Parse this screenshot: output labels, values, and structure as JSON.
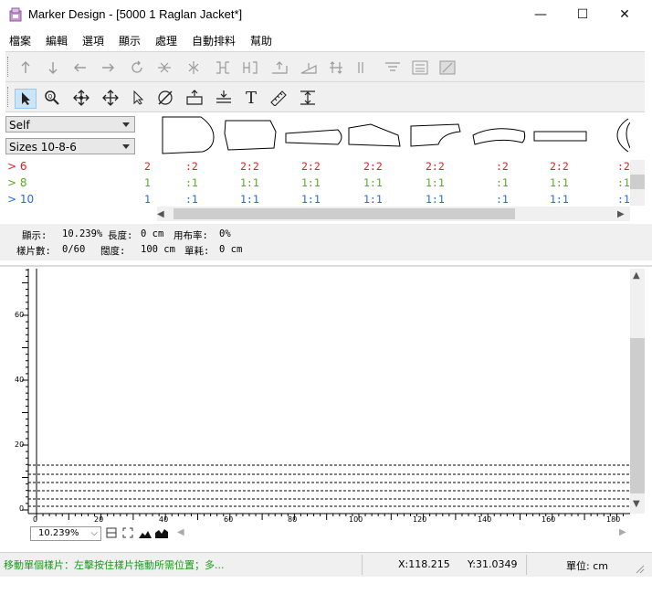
{
  "window": {
    "title": "Marker Design - [5000 1 Raglan Jacket*]",
    "controls": {
      "minimize": "—",
      "maximize": "☐",
      "close": "✕"
    }
  },
  "menu": [
    "檔案",
    "編輯",
    "選項",
    "顯示",
    "處理",
    "自動排料",
    "幫助"
  ],
  "toolbar1_icons": [
    "move-up-icon",
    "move-down-icon",
    "move-left-icon",
    "move-right-icon",
    "rotate-icon",
    "flip-vertical-icon",
    "flip-horizontal-icon",
    "join-right-icon",
    "join-left-icon",
    "tilt-up-icon",
    "tilt-down-icon",
    "spread-vertical-icon",
    "align-bar-icon",
    "align-top-icon",
    "align-center-icon",
    "select-all-icon"
  ],
  "toolbar2_icons": [
    "select-arrow-icon",
    "zoom-icon",
    "pan-icon",
    "move-cross-icon",
    "pointer-icon",
    "measure-icon",
    "piece-info-icon",
    "bundle-icon",
    "text-icon",
    "ruler-icon",
    "fit-height-icon"
  ],
  "toolbar2_glyphs": {
    "text": "T"
  },
  "selectors": {
    "fabric": "Self",
    "sizes": "Sizes 10-8-6"
  },
  "sizes": [
    {
      "label": "> 6",
      "color": "#e02020",
      "cells": [
        "2",
        ":2",
        "2:2",
        "2:2",
        "2:2",
        "2:2",
        ":2",
        "2:2",
        ":2"
      ]
    },
    {
      "label": "> 8",
      "color": "#5aaa20",
      "cells": [
        "1",
        ":1",
        "1:1",
        "1:1",
        "1:1",
        "1:1",
        ":1",
        "1:1",
        ":1"
      ]
    },
    {
      "label": "> 10",
      "color": "#2a6ad8",
      "cells": [
        "1",
        ":1",
        "1:1",
        "1:1",
        "1:1",
        "1:1",
        ":1",
        "1:1",
        ":1"
      ]
    }
  ],
  "info": {
    "display_label": "顯示:",
    "display_value": "10.239%",
    "length_label": "長度:",
    "length_value": "0 cm",
    "usage_label": "用布率:",
    "usage_value": "0%",
    "pieces_label": "樣片數:",
    "pieces_value": "0/60",
    "width_label": "闊度:",
    "width_value": "100 cm",
    "unit_usage_label": "單耗:",
    "unit_usage_value": "0 cm"
  },
  "ruler": {
    "y_labels": [
      "60",
      "40",
      "20",
      "0"
    ],
    "x_labels": [
      "0",
      "20",
      "40",
      "60",
      "80",
      "100",
      "120",
      "140",
      "160",
      "180"
    ]
  },
  "zoom": {
    "value": "10.239%"
  },
  "status": {
    "hint": "移動單個樣片：左擊按住樣片拖動所需位置；多...",
    "x": "X:118.215",
    "y": "Y:31.0349",
    "unit": "單位: cm"
  },
  "colors": {
    "red": "#e02020",
    "green": "#5aaa20",
    "blue": "#2a6ad8",
    "status_green": "#1a9a1a"
  }
}
